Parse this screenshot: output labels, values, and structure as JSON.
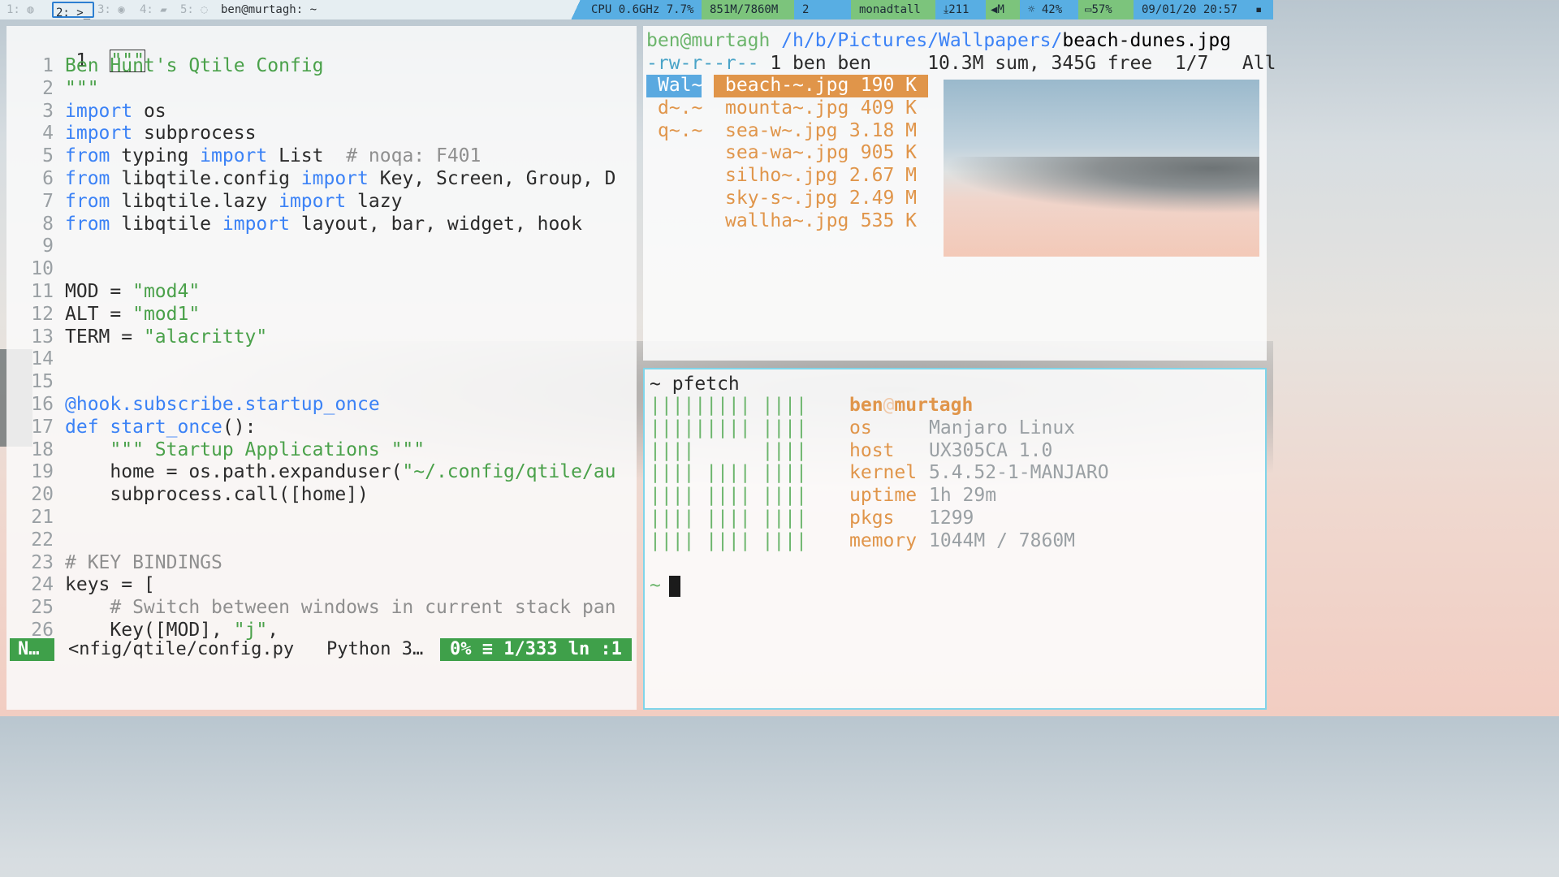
{
  "topbar": {
    "ws1": "1:",
    "ws2": "2:",
    "ws2_icon": ">_",
    "ws3": "3:",
    "ws4": "4:",
    "ws5": "5:",
    "window_title": "ben@murtagh: ~",
    "cpu": "CPU 0.6GHz 7.7%",
    "mem": "851M/7860M",
    "procs": "2",
    "layout": "monadtall",
    "updates": "211",
    "volume": "M",
    "brightness": "42%",
    "battery": "57%",
    "clock": "09/01/20 20:57"
  },
  "vim": {
    "first_line_no": "1",
    "first_line_text": "\"\"\"",
    "lines": [
      {
        "n": "1",
        "html": "<span class='st'>Ben Hunt's Qtile Config</span>"
      },
      {
        "n": "2",
        "html": "<span class='st'>\"\"\"</span>"
      },
      {
        "n": "3",
        "html": "<span class='kw'>import</span> os"
      },
      {
        "n": "4",
        "html": "<span class='kw'>import</span> subprocess"
      },
      {
        "n": "5",
        "html": "<span class='kw'>from</span> typing <span class='kw'>import</span> List  <span class='cm'># noqa: F401</span>"
      },
      {
        "n": "6",
        "html": "<span class='kw'>from</span> libqtile.config <span class='kw'>import</span> Key, Screen, Group, D"
      },
      {
        "n": "7",
        "html": "<span class='kw'>from</span> libqtile.lazy <span class='kw'>import</span> lazy"
      },
      {
        "n": "8",
        "html": "<span class='kw'>from</span> libqtile <span class='kw'>import</span> layout, bar, widget, hook"
      },
      {
        "n": "9",
        "html": ""
      },
      {
        "n": "10",
        "html": ""
      },
      {
        "n": "11",
        "html": "MOD = <span class='st'>\"mod4\"</span>"
      },
      {
        "n": "12",
        "html": "ALT = <span class='st'>\"mod1\"</span>"
      },
      {
        "n": "13",
        "html": "TERM = <span class='st'>\"alacritty\"</span>"
      },
      {
        "n": "14",
        "html": ""
      },
      {
        "n": "15",
        "html": ""
      },
      {
        "n": "16",
        "html": "<span class='dec'>@hook.subscribe.startup_once</span>"
      },
      {
        "n": "17",
        "html": "<span class='kw'>def</span> <span class='fn'>start_once</span>():"
      },
      {
        "n": "18",
        "html": "    <span class='st'>\"\"\" Startup Applications \"\"\"</span>"
      },
      {
        "n": "19",
        "html": "    home = os.path.expanduser(<span class='st'>\"~/.config/qtile/au</span>"
      },
      {
        "n": "20",
        "html": "    subprocess.call([home])"
      },
      {
        "n": "21",
        "html": ""
      },
      {
        "n": "22",
        "html": ""
      },
      {
        "n": "23",
        "html": "<span class='cm'># KEY BINDINGS</span>"
      },
      {
        "n": "24",
        "html": "keys = ["
      },
      {
        "n": "25",
        "html": "    <span class='cm'># Switch between windows in current stack pan</span>"
      },
      {
        "n": "26",
        "html": "    Key([MOD], <span class='st'>\"j\"</span>,"
      }
    ],
    "status": {
      "mode": "N…",
      "file": "<nfig/qtile/config.py",
      "filetype": "Python 3…",
      "position": "0% ≡ 1/333 ln :1"
    }
  },
  "ranger": {
    "user": "ben@murtagh",
    "dir": " /h/b/Pictures/Wallpapers/",
    "file": "beach-dunes.jpg",
    "perm": "-rw-r--r--",
    "info": " 1 ben ben     10.3M sum, 345G free  1/7   All",
    "col1": [
      "Wal~",
      "d~.~",
      "q~.~"
    ],
    "files": [
      {
        "name": "beach-~.jpg",
        "size": "190 K"
      },
      {
        "name": "mounta~.jpg",
        "size": "409 K"
      },
      {
        "name": "sea-w~.jpg",
        "size": "3.18 M"
      },
      {
        "name": "sea-wa~.jpg",
        "size": "905 K"
      },
      {
        "name": "silho~.jpg",
        "size": "2.67 M"
      },
      {
        "name": "sky-s~.jpg",
        "size": "2.49 M"
      },
      {
        "name": "wallha~.jpg",
        "size": "535 K"
      }
    ]
  },
  "pfetch": {
    "command": "~ pfetch",
    "logo": [
      "||||||||| ||||",
      "||||||||| ||||",
      "||||      ||||",
      "|||| |||| ||||",
      "|||| |||| ||||",
      "|||| |||| ||||",
      "|||| |||| ||||"
    ],
    "user": "ben",
    "at": "@",
    "host": "murtagh",
    "rows": [
      {
        "k": "os",
        "v": "Manjaro Linux"
      },
      {
        "k": "host",
        "v": "UX305CA 1.0"
      },
      {
        "k": "kernel",
        "v": "5.4.52-1-MANJARO"
      },
      {
        "k": "uptime",
        "v": "1h 29m"
      },
      {
        "k": "pkgs",
        "v": "1299"
      },
      {
        "k": "memory",
        "v": "1044M / 7860M"
      }
    ],
    "prompt": "~"
  }
}
